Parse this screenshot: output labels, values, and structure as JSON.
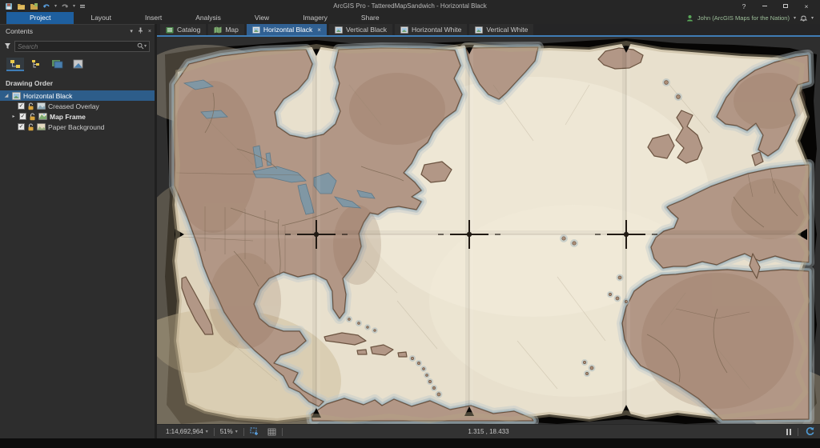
{
  "window": {
    "title": "ArcGIS Pro - TatteredMapSandwich - Horizontal Black",
    "help_glyph": "?",
    "close_glyph": "×"
  },
  "ribbon": {
    "tabs": [
      {
        "label": "Project",
        "active": true
      },
      {
        "label": "Layout"
      },
      {
        "label": "Insert"
      },
      {
        "label": "Analysis"
      },
      {
        "label": "View"
      },
      {
        "label": "Imagery"
      },
      {
        "label": "Share"
      }
    ],
    "account": {
      "user": "John (ArcGIS Maps for the Nation)"
    }
  },
  "view_tabs": [
    {
      "label": "Catalog"
    },
    {
      "label": "Map"
    },
    {
      "label": "Horizontal Black",
      "active": true,
      "close_glyph": "×"
    },
    {
      "label": "Vertical Black"
    },
    {
      "label": "Horizontal White"
    },
    {
      "label": "Vertical White"
    }
  ],
  "contents": {
    "title": "Contents",
    "search_placeholder": "Search",
    "section": "Drawing Order",
    "tree": [
      {
        "label": "Horizontal Black",
        "type": "layout",
        "selected": true
      },
      {
        "label": "Creased Overlay",
        "checked": true,
        "locked": true
      },
      {
        "label": "Map Frame",
        "checked": true,
        "locked": true,
        "expandable": true
      },
      {
        "label": "Paper Background",
        "checked": true,
        "locked": true
      }
    ]
  },
  "status_bar": {
    "scale": "1:14,692,964",
    "zoom": "51%",
    "coordinates": "1.315 , 18.433"
  },
  "glyphs": {
    "check": "✓",
    "expanded": "◢",
    "collapsed": "▸",
    "dropdown": "▾"
  },
  "map": {
    "layout_name": "Horizontal Black",
    "style": "antique tattered folded paper map on black layout background",
    "features": [
      "North America",
      "Hudson Bay",
      "Great Lakes",
      "Greenland",
      "Iceland",
      "British Isles",
      "Scandinavia",
      "Western Europe",
      "Northwest Africa",
      "Caribbean islands",
      "northern South America",
      "Atlantic Ocean"
    ],
    "colors": {
      "view_background": "#2e2e2e",
      "tatter_black": "#060504",
      "paper": "#e8e0cd",
      "paper_light": "#f4eede",
      "paper_tan": "#c9b894",
      "land": "#b29786",
      "land_dark": "#8f6f57",
      "coast_ring": "#a6b8bf",
      "lake": "#8097a4",
      "accent_blue": "#3f7cb5"
    }
  }
}
